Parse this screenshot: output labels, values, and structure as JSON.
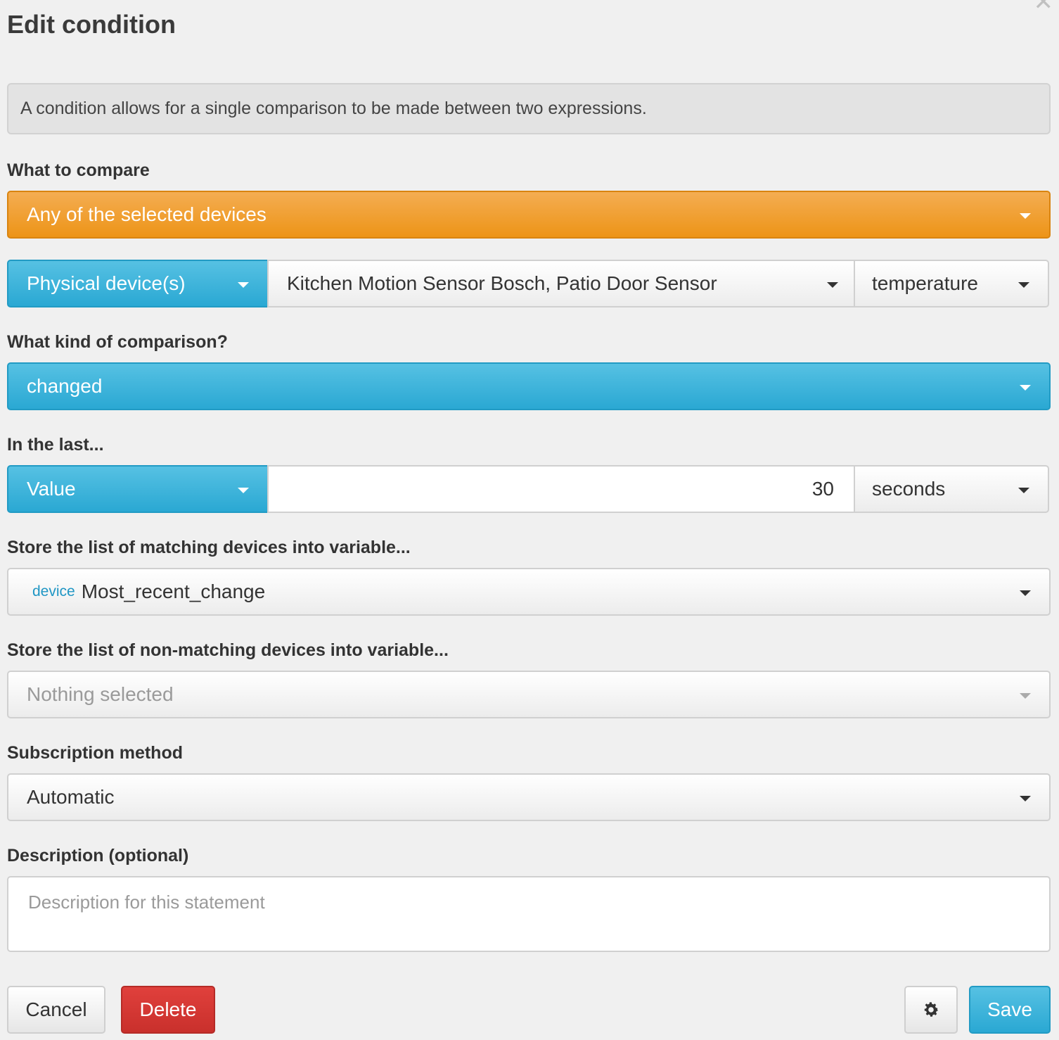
{
  "dialog": {
    "title": "Edit condition",
    "close_icon": "close-icon",
    "info_text": "A condition allows for a single comparison to be made between two expressions."
  },
  "compare": {
    "label": "What to compare",
    "selected": "Any of the selected devices",
    "source_type": "Physical device(s)",
    "devices": "Kitchen Motion Sensor Bosch, Patio Door Sensor",
    "attribute": "temperature"
  },
  "comparison": {
    "label": "What kind of comparison?",
    "selected": "changed"
  },
  "in_last": {
    "label": "In the last...",
    "type": "Value",
    "value": "30",
    "unit": "seconds"
  },
  "matching_var": {
    "label": "Store the list of matching devices into variable...",
    "tag": "device",
    "value": "Most_recent_change"
  },
  "non_matching_var": {
    "label": "Store the list of non-matching devices into variable...",
    "value": "Nothing selected"
  },
  "subscription": {
    "label": "Subscription method",
    "selected": "Automatic"
  },
  "description": {
    "label": "Description (optional)",
    "placeholder": "Description for this statement"
  },
  "footer": {
    "cancel_label": "Cancel",
    "delete_label": "Delete",
    "settings_icon": "gear-icon",
    "save_label": "Save"
  },
  "colors": {
    "orange": "#ed9417",
    "blue": "#2aa8d3",
    "danger": "#c9302c"
  }
}
